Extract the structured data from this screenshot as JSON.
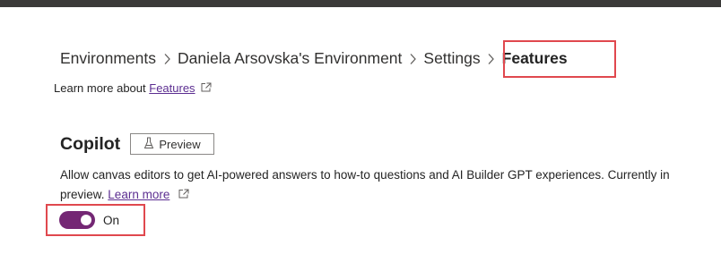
{
  "breadcrumb": {
    "items": [
      "Environments",
      "Daniela Arsovska's Environment",
      "Settings"
    ],
    "current": "Features"
  },
  "learn": {
    "prefix": "Learn more about ",
    "link": "Features"
  },
  "copilot": {
    "title": "Copilot",
    "preview_label": "Preview",
    "description": "Allow canvas editors to get AI-powered answers to how-to questions and AI Builder GPT experiences. Currently in preview.",
    "learn_more": "Learn more",
    "toggle_label": "On",
    "toggle_on": true
  },
  "colors": {
    "accent": "#742774",
    "link": "#5c2e91",
    "highlight": "#e0484e"
  },
  "icons": [
    "chevron-right-icon",
    "external-link-icon",
    "flask-icon"
  ]
}
